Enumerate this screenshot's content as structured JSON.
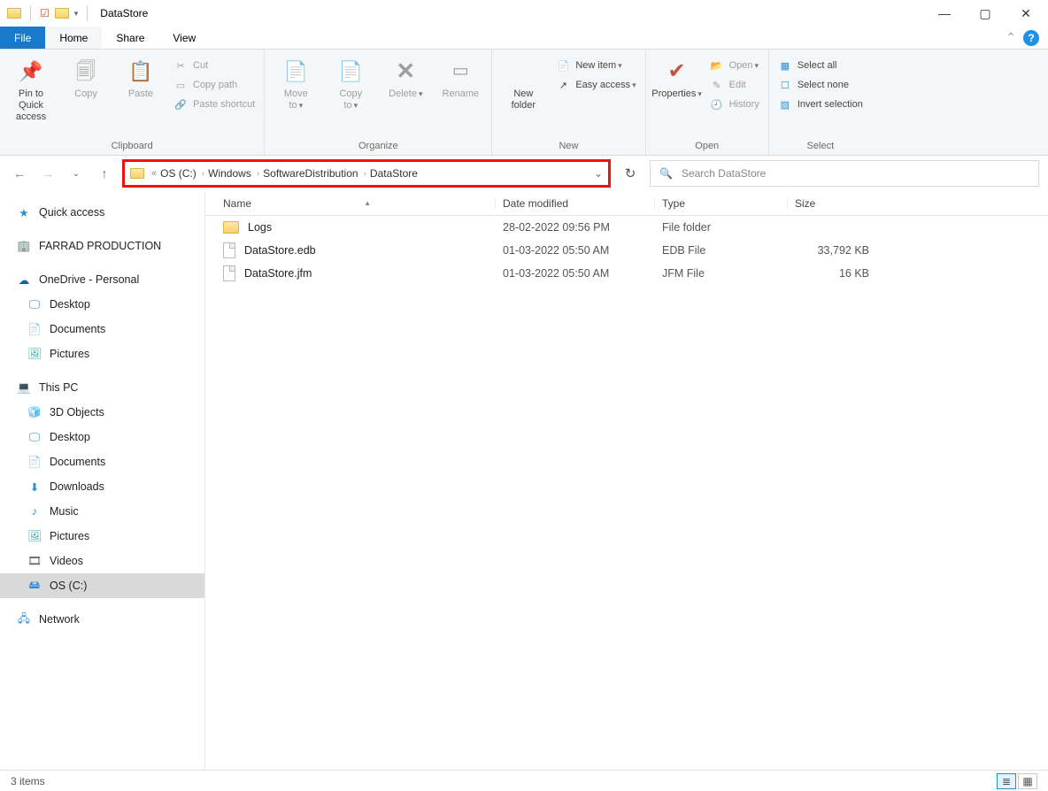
{
  "window": {
    "title": "DataStore"
  },
  "tabs": {
    "file": "File",
    "home": "Home",
    "share": "Share",
    "view": "View"
  },
  "ribbon": {
    "clipboard": {
      "label": "Clipboard",
      "pin": "Pin to Quick\naccess",
      "copy": "Copy",
      "paste": "Paste",
      "cut": "Cut",
      "copy_path": "Copy path",
      "paste_shortcut": "Paste shortcut"
    },
    "organize": {
      "label": "Organize",
      "move_to": "Move\nto",
      "copy_to": "Copy\nto",
      "delete": "Delete",
      "rename": "Rename"
    },
    "new": {
      "label": "New",
      "new_folder": "New\nfolder",
      "new_item": "New item",
      "easy_access": "Easy access"
    },
    "open": {
      "label": "Open",
      "properties": "Properties",
      "open": "Open",
      "edit": "Edit",
      "history": "History"
    },
    "select": {
      "label": "Select",
      "select_all": "Select all",
      "select_none": "Select none",
      "invert": "Invert selection"
    }
  },
  "breadcrumb": {
    "items": [
      "OS (C:)",
      "Windows",
      "SoftwareDistribution",
      "DataStore"
    ]
  },
  "search": {
    "placeholder": "Search DataStore"
  },
  "sidebar": {
    "quick_access": "Quick access",
    "farrad": "FARRAD PRODUCTION",
    "onedrive": "OneDrive - Personal",
    "od_desktop": "Desktop",
    "od_documents": "Documents",
    "od_pictures": "Pictures",
    "this_pc": "This PC",
    "pc_3d": "3D Objects",
    "pc_desktop": "Desktop",
    "pc_documents": "Documents",
    "pc_downloads": "Downloads",
    "pc_music": "Music",
    "pc_pictures": "Pictures",
    "pc_videos": "Videos",
    "pc_os": "OS (C:)",
    "network": "Network"
  },
  "columns": {
    "name": "Name",
    "date": "Date modified",
    "type": "Type",
    "size": "Size"
  },
  "files": [
    {
      "name": "Logs",
      "date": "28-02-2022 09:56 PM",
      "type": "File folder",
      "size": ""
    },
    {
      "name": "DataStore.edb",
      "date": "01-03-2022 05:50 AM",
      "type": "EDB File",
      "size": "33,792 KB"
    },
    {
      "name": "DataStore.jfm",
      "date": "01-03-2022 05:50 AM",
      "type": "JFM File",
      "size": "16 KB"
    }
  ],
  "status": {
    "items": "3 items"
  }
}
